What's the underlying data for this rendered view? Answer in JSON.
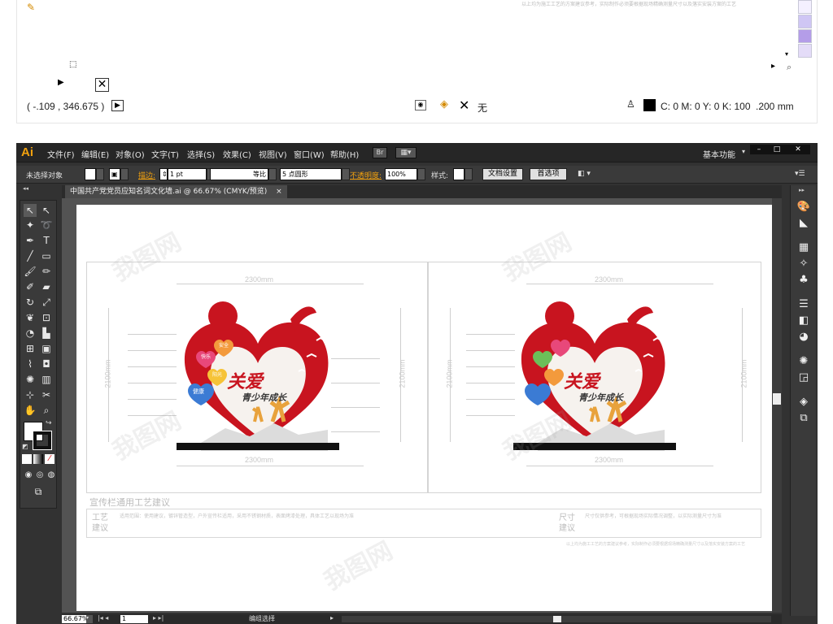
{
  "top_strip": {
    "coords": "( -.109 , 346.675 )",
    "fill_none_label": "无",
    "color_readout": "C: 0 M: 0 Y: 0 K: 100",
    "stroke_size": ".200 mm",
    "watermark_line": "以上均为施工工艺的方案建议参考，实际制作必须要根据现场精确测量尺寸以及落实安装方案的工艺"
  },
  "app": {
    "logo": "Ai",
    "menus": [
      "文件(F)",
      "编辑(E)",
      "对象(O)",
      "文字(T)",
      "选择(S)",
      "效果(C)",
      "视图(V)",
      "窗口(W)",
      "帮助(H)"
    ],
    "bridge_label": "Br",
    "workspace": "基本功能",
    "window_controls": [
      "–",
      "□",
      "✕"
    ]
  },
  "control_bar": {
    "selection_label": "未选择对象",
    "stroke_label": "描边:",
    "stroke_value": "1 pt",
    "line_style": "等比",
    "brush_value": "5 点圆形",
    "opacity_label": "不透明度:",
    "opacity_value": "100%",
    "style_label": "样式:",
    "doc_setup_button": "文档设置",
    "prefs_button": "首选项"
  },
  "document": {
    "tab_title": "中国共产党党员应知名词文化墙.ai @ 66.67% (CMYK/预览)",
    "tab_close": "×"
  },
  "artwork": {
    "width_label": "2300mm",
    "height_label": "2100mm",
    "slogan_main": "关爱",
    "slogan_sub": "青少年成长",
    "hearts": [
      "快乐",
      "安全",
      "阳光",
      "健康"
    ],
    "section_title": "宣传栏通用工艺建议",
    "craft_label": "工艺建议",
    "size_label": "尺寸建议",
    "craft_text": "适用范围：使用建议，镀锌管造型，户外宣传栏适用，采用不锈钢材质，表面烤漆处理，具体工艺以现场为准",
    "size_text": "尺寸仅供参考，可根据现场实际情况调整，以实际测量尺寸为准",
    "footnote": "以上均为施工工艺的方案建议参考，实际制作必须要根据现场精确测量尺寸以及落实安装方案的工艺",
    "watermark": "我图网"
  },
  "status_bar": {
    "zoom": "66.67%",
    "page": "1",
    "status_text": "编组选择"
  },
  "colors": {
    "accent_red": "#c8141f",
    "ai_orange": "#f2a10e",
    "ui_dark": "#323232"
  }
}
